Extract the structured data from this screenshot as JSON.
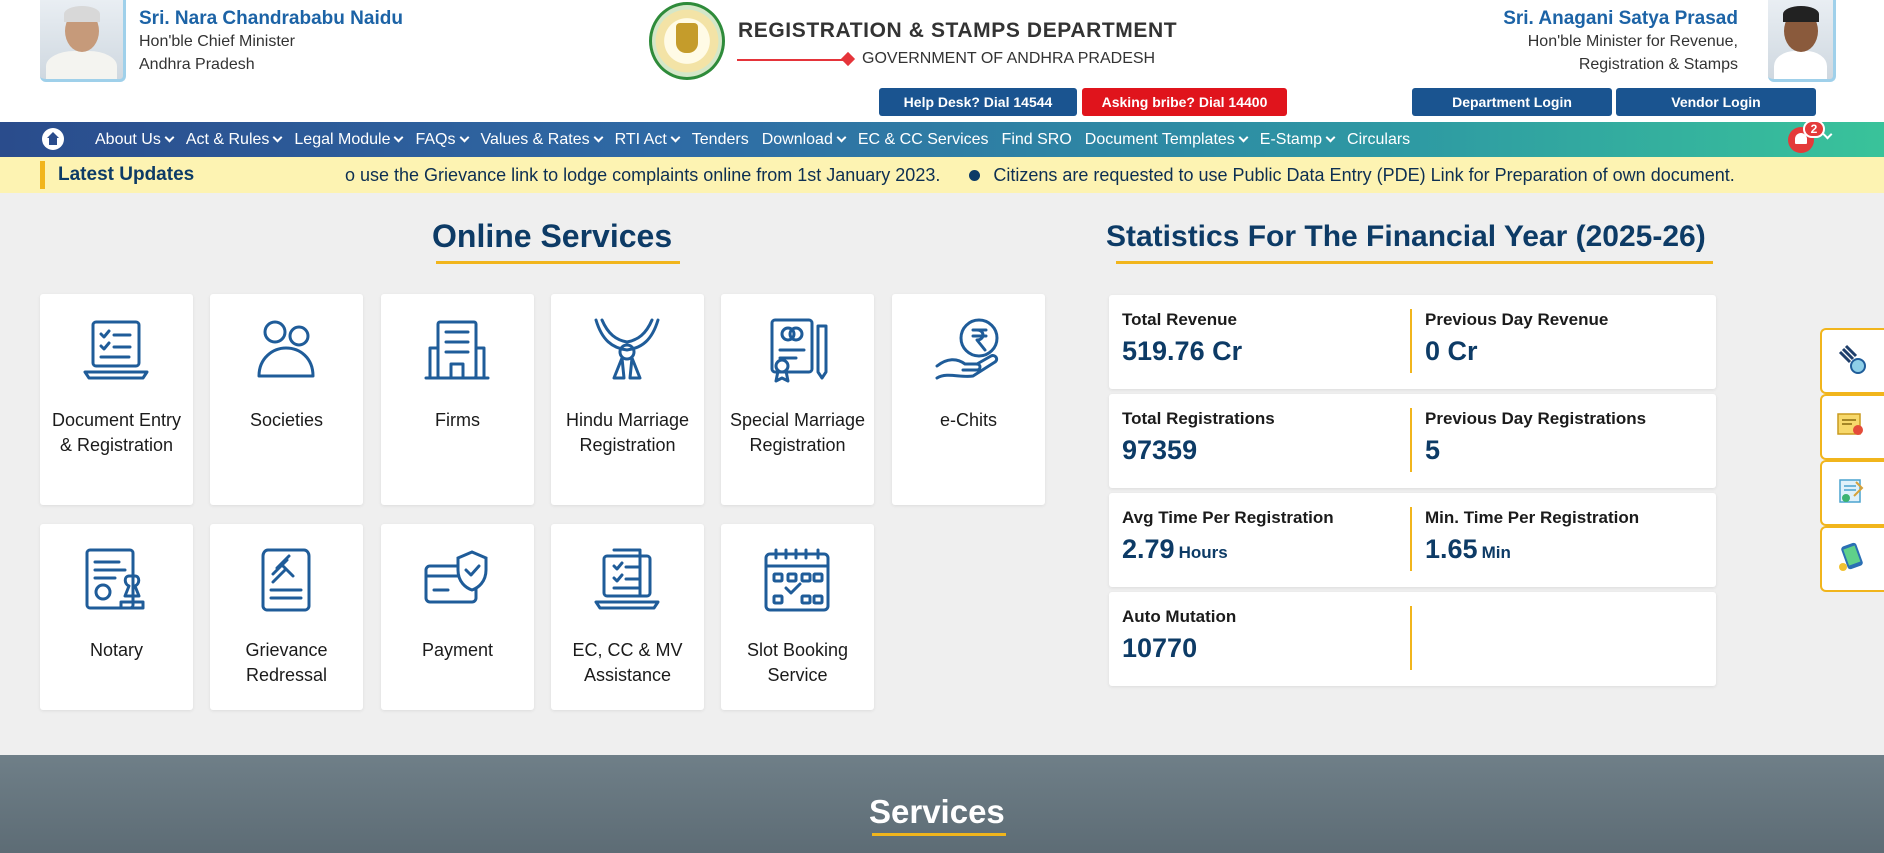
{
  "header": {
    "cm": {
      "name": "Sri. Nara Chandrababu Naidu",
      "role_line1": "Hon'ble Chief Minister",
      "role_line2": "Andhra Pradesh"
    },
    "department": {
      "title": "REGISTRATION & STAMPS DEPARTMENT",
      "government": "GOVERNMENT OF ANDHRA PRADESH"
    },
    "minister": {
      "name": "Sri. Anagani Satya Prasad",
      "role_line1": "Hon'ble Minister for Revenue,",
      "role_line2": "Registration & Stamps"
    },
    "help_desk": "Help Desk? Dial 14544",
    "bribe": "Asking bribe? Dial 14400",
    "department_login": "Department Login",
    "vendor_login": "Vendor Login"
  },
  "nav": {
    "items": [
      {
        "label": "About Us",
        "dropdown": true
      },
      {
        "label": "Act & Rules",
        "dropdown": true
      },
      {
        "label": "Legal Module",
        "dropdown": true
      },
      {
        "label": "FAQs",
        "dropdown": true
      },
      {
        "label": "Values & Rates",
        "dropdown": true
      },
      {
        "label": "RTI Act",
        "dropdown": true
      },
      {
        "label": "Tenders",
        "dropdown": false
      },
      {
        "label": "Download",
        "dropdown": true
      },
      {
        "label": "EC & CC Services",
        "dropdown": false
      },
      {
        "label": "Find SRO",
        "dropdown": false
      },
      {
        "label": "Document Templates",
        "dropdown": true
      },
      {
        "label": "E-Stamp",
        "dropdown": true
      },
      {
        "label": "Circulars",
        "dropdown": false
      }
    ],
    "notification_count": "2"
  },
  "updates": {
    "label": "Latest Updates",
    "items": [
      "o use the Grievance link to lodge complaints online from 1st January 2023.",
      "Citizens are requested to use Public Data Entry (PDE) Link for Preparation of own document."
    ]
  },
  "online_services": {
    "title": "Online Services",
    "cards": [
      {
        "label": "Document Entry & Registration",
        "icon": "laptop-checklist-icon"
      },
      {
        "label": "Societies",
        "icon": "people-icon"
      },
      {
        "label": "Firms",
        "icon": "building-icon"
      },
      {
        "label": "Hindu Marriage Registration",
        "icon": "garland-icon"
      },
      {
        "label": "Special Marriage Registration",
        "icon": "certificate-rings-icon"
      },
      {
        "label": "e-Chits",
        "icon": "rupee-hand-icon"
      },
      {
        "label": "Notary",
        "icon": "notary-stamp-icon"
      },
      {
        "label": "Grievance Redressal",
        "icon": "gavel-document-icon"
      },
      {
        "label": "Payment",
        "icon": "card-shield-icon"
      },
      {
        "label": "EC, CC & MV Assistance",
        "icon": "laptop-document-icon"
      },
      {
        "label": "Slot Booking Service",
        "icon": "calendar-check-icon"
      }
    ]
  },
  "statistics": {
    "title": "Statistics For The Financial Year (2025-26)",
    "rows": [
      {
        "left_label": "Total Revenue",
        "left_value": "519.76 Cr",
        "right_label": "Previous Day Revenue",
        "right_value": "0 Cr"
      },
      {
        "left_label": "Total Registrations",
        "left_value": "97359",
        "right_label": "Previous Day Registrations",
        "right_value": "5"
      },
      {
        "left_label": "Avg Time Per Registration",
        "left_value": "2.79",
        "left_unit": "Hours",
        "right_label": "Min. Time Per Registration",
        "right_value": "1.65",
        "right_unit": "Min"
      },
      {
        "left_label": "Auto Mutation",
        "left_value": "10770"
      }
    ]
  },
  "side_tools": [
    "auction-globe-icon",
    "certificate-ribbon-icon",
    "document-check-icon",
    "phone-coins-icon"
  ],
  "services": {
    "title": "Services"
  },
  "colors": {
    "primary": "#1a5490",
    "accent": "#f1b51c",
    "danger": "#e0141c",
    "heading": "#0d3b66"
  }
}
